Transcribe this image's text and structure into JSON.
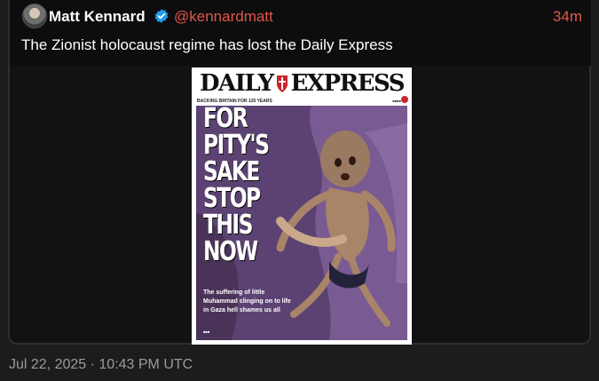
{
  "tweet": {
    "author_name": "Matt Kennard",
    "verified": true,
    "handle": "@kennardmatt",
    "time_ago": "34m",
    "text": "The Zionist holocaust regime has lost the Daily Express",
    "timestamp": "Jul 22, 2025 · 10:43 PM UTC"
  },
  "newspaper": {
    "masthead_left": "DAILY",
    "masthead_right": "EXPRESS",
    "strapline": "BACKING BRITAIN FOR 125 YEARS",
    "headline_lines": [
      "FOR",
      "PITY'S",
      "SAKE",
      "STOP",
      "THIS",
      "NOW"
    ],
    "subheadline": "The suffering of little Muhammad clinging on to life in Gaza hell shames us all"
  },
  "colors": {
    "accent": "#e0564a",
    "verified_badge": "#1d9bf0",
    "masthead_red": "#c9252b"
  },
  "icons": {
    "verified": "verified-badge-icon",
    "avatar": "avatar"
  }
}
